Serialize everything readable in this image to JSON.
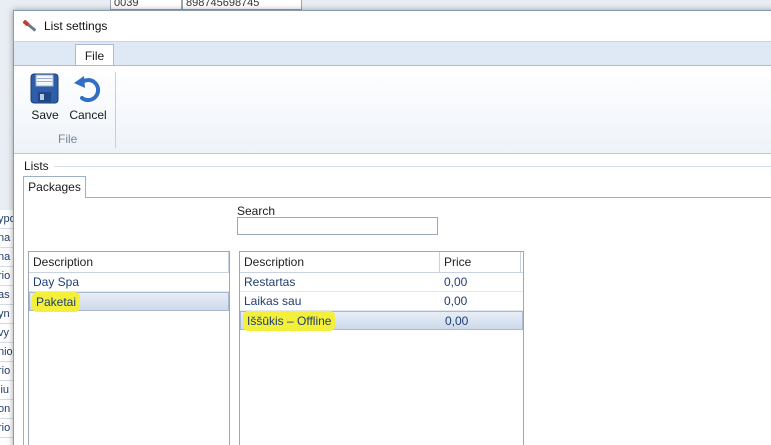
{
  "background": {
    "top_cells": [
      "0039",
      "898745698745"
    ],
    "left_rows": [
      "ypo",
      "na",
      "na",
      "rio",
      "as",
      "yn",
      "vy",
      "nio",
      "rio",
      "liu",
      "on",
      "rio"
    ]
  },
  "dialog": {
    "title": "List settings"
  },
  "ribbon": {
    "tab_file": "File",
    "save_label": "Save",
    "cancel_label": "Cancel",
    "group_label": "File"
  },
  "lists": {
    "section_label": "Lists",
    "tab_packages": "Packages",
    "search_label": "Search",
    "search_value": "",
    "left_grid": {
      "headers": [
        "Description"
      ],
      "rows": [
        {
          "description": "Day Spa"
        },
        {
          "description": "Paketai"
        }
      ]
    },
    "right_grid": {
      "headers": [
        "Description",
        "Price"
      ],
      "rows": [
        {
          "description": "Restartas",
          "price": "0,00"
        },
        {
          "description": "Laikas sau",
          "price": "0,00"
        },
        {
          "description": "Iššūkis – Offline",
          "price": "0,00"
        }
      ]
    }
  },
  "colors": {
    "highlight": "#f3ef3a",
    "selection": "#cdd9ea",
    "ribbon_bg": "#dfe9f5"
  }
}
